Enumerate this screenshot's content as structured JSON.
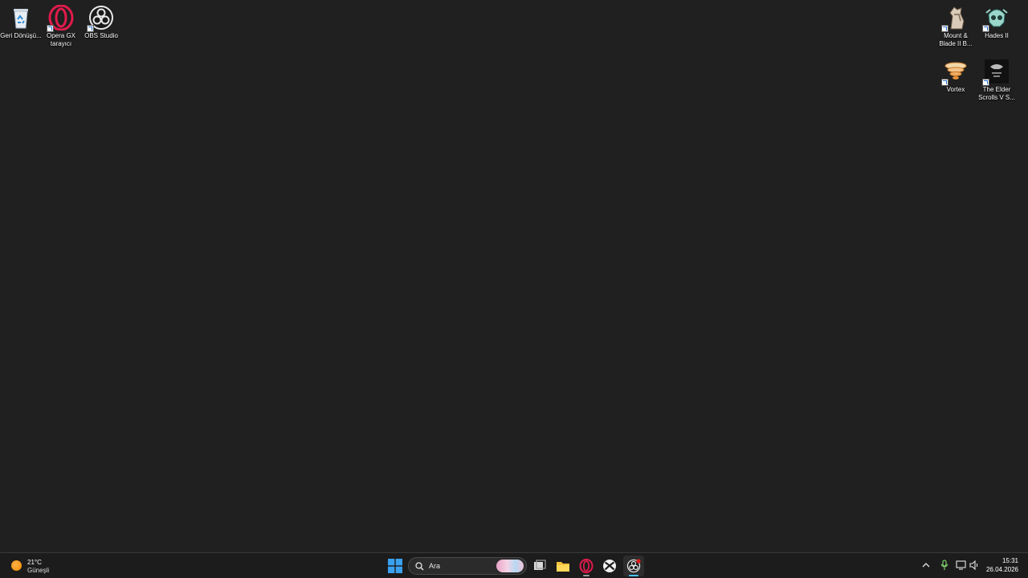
{
  "desktop": {
    "icons_left": [
      {
        "label": "Geri Dönüşü...",
        "icon": "recycle-bin-icon"
      },
      {
        "label": "Opera GX tarayıcı",
        "icon": "opera-gx-icon"
      },
      {
        "label": "OBS Studio",
        "icon": "obs-studio-icon"
      }
    ],
    "icons_right": [
      {
        "label": "Mount & Blade II B...",
        "icon": "mount-blade-icon"
      },
      {
        "label": "Hades II",
        "icon": "hades-icon"
      },
      {
        "label": "Vortex",
        "icon": "vortex-icon"
      },
      {
        "label": "The Elder Scrolls V S...",
        "icon": "skyrim-icon"
      }
    ]
  },
  "taskbar": {
    "weather": {
      "temp": "21°C",
      "condition": "Güneşli"
    },
    "search": {
      "placeholder": "Ara"
    },
    "pinned": [
      "start-icon",
      "task-view-icon",
      "file-explorer-icon",
      "opera-gx-icon",
      "xbox-icon",
      "obs-studio-icon"
    ],
    "tray": [
      "chevron-up-icon",
      "microphone-icon",
      "network-icon",
      "volume-icon"
    ],
    "clock": {
      "time": "15:31",
      "date": "26.04.2026"
    },
    "accent_color": "#4cc2ff"
  }
}
